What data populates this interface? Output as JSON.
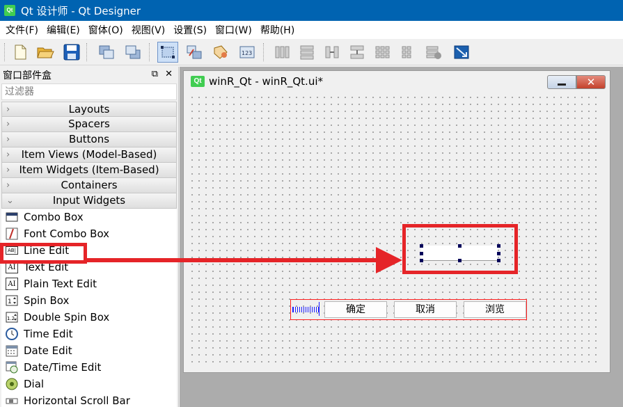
{
  "app": {
    "title": "Qt 设计师 - Qt Designer",
    "logo_text": "Qt"
  },
  "menubar": {
    "items": [
      "文件(F)",
      "编辑(E)",
      "窗体(O)",
      "视图(V)",
      "设置(S)",
      "窗口(W)",
      "帮助(H)"
    ]
  },
  "toolbar": {
    "icons": [
      "new-file-icon",
      "open-folder-icon",
      "save-icon",
      "bring-to-front-icon",
      "send-to-back-icon",
      "edit-widgets-icon",
      "edit-signals-slots-icon",
      "edit-buddies-icon",
      "edit-tab-order-icon",
      "layout-horizontal-icon",
      "layout-vertical-icon",
      "layout-horizontal-splitter-icon",
      "layout-vertical-splitter-icon",
      "layout-grid-icon",
      "layout-form-icon",
      "break-layout-icon",
      "adjust-size-icon"
    ]
  },
  "widget_box": {
    "title": "窗口部件盒",
    "filter_placeholder": "过滤器",
    "categories": [
      "Layouts",
      "Spacers",
      "Buttons",
      "Item Views (Model-Based)",
      "Item Widgets (Item-Based)",
      "Containers",
      "Input Widgets"
    ],
    "items": [
      {
        "label": "Combo Box",
        "icon": "combo-box-icon"
      },
      {
        "label": "Font Combo Box",
        "icon": "font-combo-box-icon"
      },
      {
        "label": "Line Edit",
        "icon": "line-edit-icon"
      },
      {
        "label": "Text Edit",
        "icon": "text-edit-icon"
      },
      {
        "label": "Plain Text Edit",
        "icon": "plain-text-edit-icon"
      },
      {
        "label": "Spin Box",
        "icon": "spin-box-icon"
      },
      {
        "label": "Double Spin Box",
        "icon": "double-spin-box-icon"
      },
      {
        "label": "Time Edit",
        "icon": "time-edit-icon"
      },
      {
        "label": "Date Edit",
        "icon": "date-edit-icon"
      },
      {
        "label": "Date/Time Edit",
        "icon": "date-time-edit-icon"
      },
      {
        "label": "Dial",
        "icon": "dial-icon"
      },
      {
        "label": "Horizontal Scroll Bar",
        "icon": "horizontal-scroll-bar-icon"
      }
    ],
    "icon_text": {
      "line_edit": "AB|",
      "text_edit": "AI",
      "plain_text_edit": "AI"
    }
  },
  "form": {
    "title": "winR_Qt - winR_Qt.ui*",
    "logo_text": "Qt",
    "buttons": {
      "ok": "确定",
      "cancel": "取消",
      "browse": "浏览"
    }
  },
  "colors": {
    "titlebar": "#0063b1",
    "annotation": "#e52428",
    "selection_handle": "#00005a",
    "qt_green": "#41cd52"
  }
}
